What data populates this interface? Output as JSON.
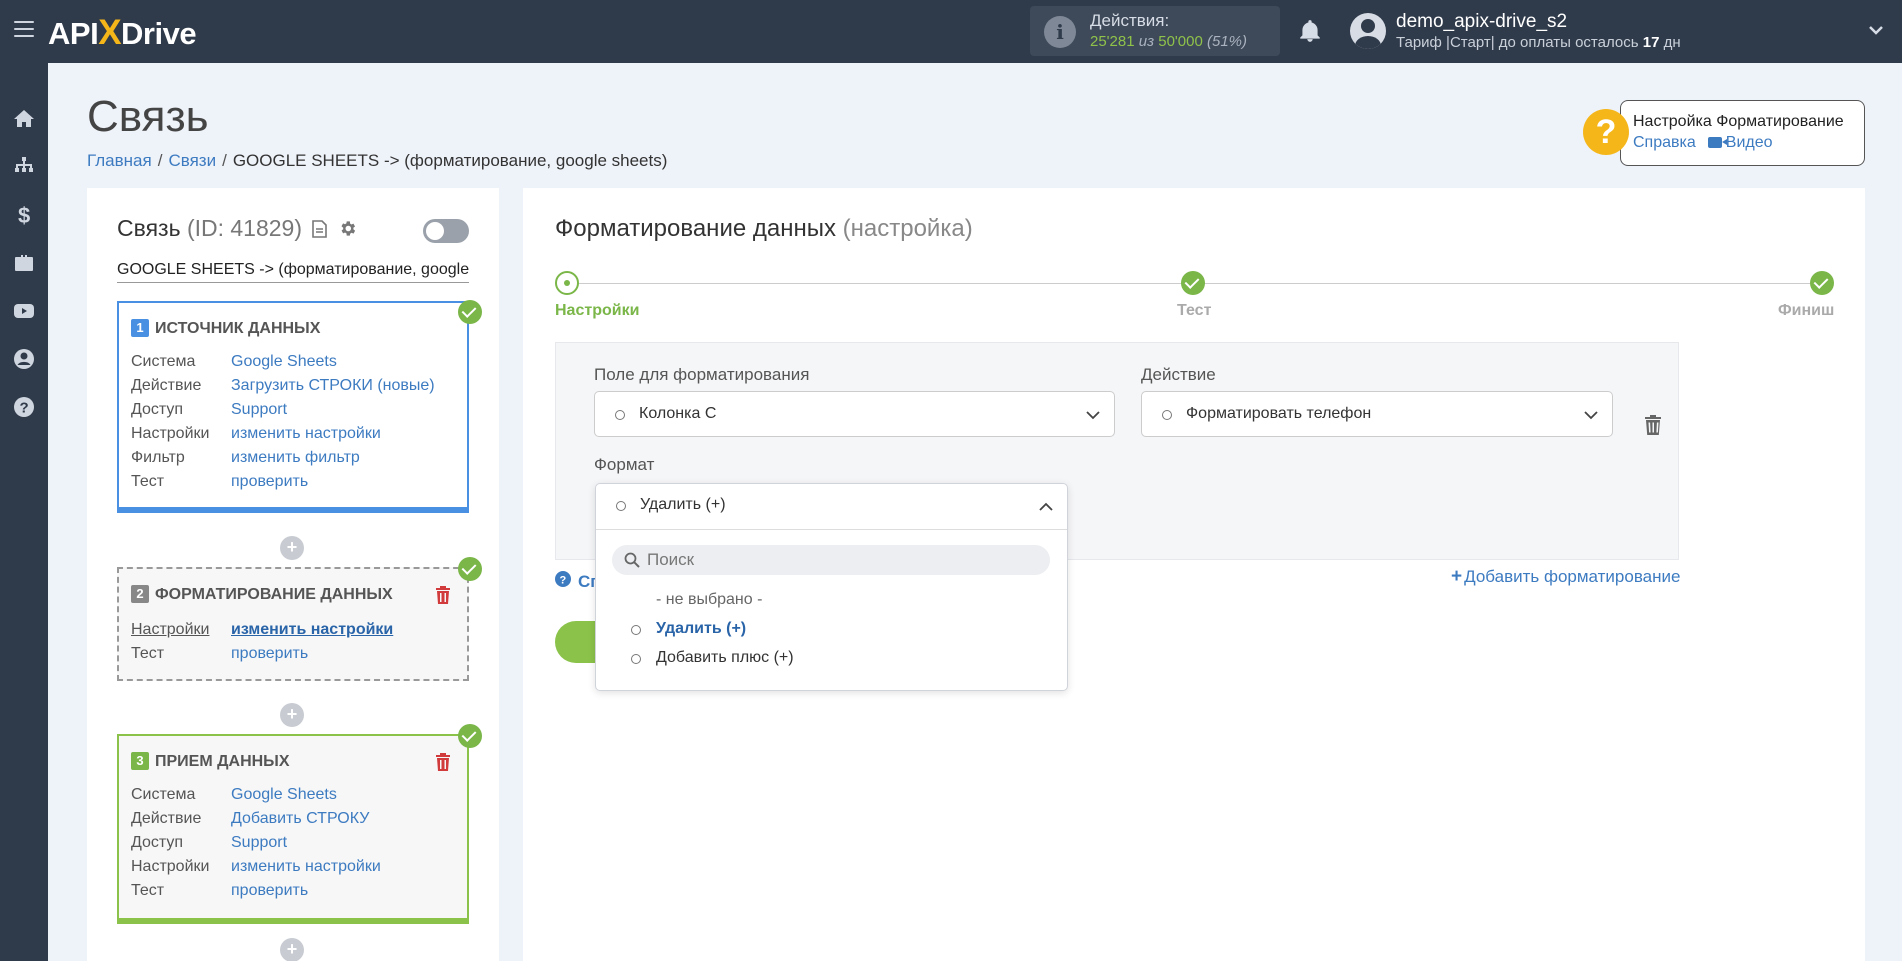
{
  "topbar": {
    "logo_api": "API",
    "logo_x": "X",
    "logo_drive": "Drive",
    "actions_label": "Действия:",
    "actions_used": "25'281",
    "actions_of": "из",
    "actions_total": "50'000",
    "actions_pct": "(51%)",
    "user_name": "demo_apix-drive_s2",
    "plan_prefix": "Тариф |Старт| до оплаты осталось",
    "plan_days": "17",
    "plan_suffix": "дн"
  },
  "sidebar": {
    "icons": [
      "home-icon",
      "sitemap-icon",
      "dollar-icon",
      "briefcase-icon",
      "youtube-icon",
      "user-circle-icon",
      "help-circle-icon"
    ]
  },
  "page": {
    "title": "Связь",
    "breadcrumb": [
      "Главная",
      "Связи",
      "GOOGLE SHEETS -> (форматирование, google sheets)"
    ]
  },
  "help": {
    "title": "Настройка Форматирование",
    "link_help": "Справка",
    "link_video": "Видео"
  },
  "left_panel": {
    "title": "Связь",
    "id_text": "(ID: 41829)",
    "connection_name": "GOOGLE SHEETS -> (форматирование, google sheets)",
    "blocks": [
      {
        "num": "1",
        "title": "ИСТОЧНИК ДАННЫХ",
        "rows": [
          {
            "k": "Система",
            "v": "Google Sheets"
          },
          {
            "k": "Действие",
            "v": "Загрузить СТРОКИ (новые)"
          },
          {
            "k": "Доступ",
            "v": "Support"
          },
          {
            "k": "Настройки",
            "v": "изменить настройки"
          },
          {
            "k": "Фильтр",
            "v": "изменить фильтр"
          },
          {
            "k": "Тест",
            "v": "проверить"
          }
        ]
      },
      {
        "num": "2",
        "title": "ФОРМАТИРОВАНИЕ ДАННЫХ",
        "rows": [
          {
            "k": "Настройки",
            "v": "изменить настройки"
          },
          {
            "k": "Тест",
            "v": "проверить"
          }
        ]
      },
      {
        "num": "3",
        "title": "ПРИЕМ ДАННЫХ",
        "rows": [
          {
            "k": "Система",
            "v": "Google Sheets"
          },
          {
            "k": "Действие",
            "v": "Добавить СТРОКУ"
          },
          {
            "k": "Доступ",
            "v": "Support"
          },
          {
            "k": "Настройки",
            "v": "изменить настройки"
          },
          {
            "k": "Тест",
            "v": "проверить"
          }
        ]
      }
    ],
    "plus": "+"
  },
  "right_panel": {
    "title": "Форматирование данных",
    "subtitle": "(настройка)",
    "steps": [
      "Настройки",
      "Тест",
      "Финиш"
    ],
    "field_label": "Поле для форматирования",
    "field_value": "Колонка С",
    "action_label": "Действие",
    "action_value": "Форматировать телефон",
    "format_label": "Формат",
    "format_value": "Удалить (+)",
    "search_placeholder": "Поиск",
    "options": [
      "- не выбрано -",
      "Удалить (+)",
      "Добавить плюс (+)"
    ],
    "add_formatting": "Добавить форматирование",
    "help_partial": "Сг"
  },
  "colors": {
    "topbar": "#2f3a4a",
    "accent_green": "#7ab648",
    "link_blue": "#3d7bc1",
    "help_yellow": "#f5b61a"
  }
}
